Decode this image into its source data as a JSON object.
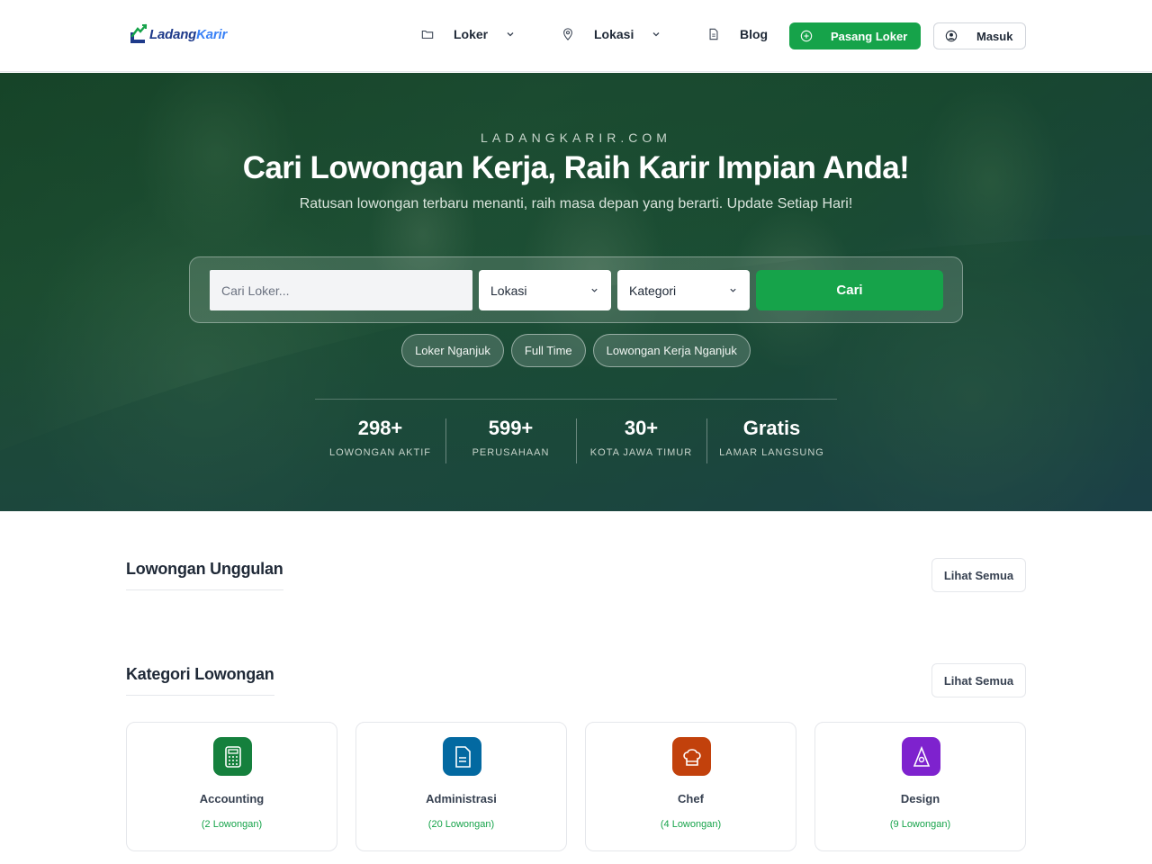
{
  "header": {
    "logo": {
      "part1": "Ladang",
      "part2": "Karir"
    },
    "nav": [
      {
        "label": "Loker",
        "icon": "folder-icon"
      },
      {
        "label": "Lokasi",
        "icon": "map-pin-icon"
      },
      {
        "label": "Blog",
        "icon": "document-icon"
      }
    ],
    "post_job_label": "Pasang Loker",
    "login_label": "Masuk"
  },
  "hero": {
    "kicker": "LADANGKARIR.COM",
    "title": "Cari Lowongan Kerja, Raih Karir Impian Anda!",
    "subtitle": "Ratusan lowongan terbaru menanti, raih masa depan yang berarti. Update Setiap Hari!",
    "search": {
      "keyword_placeholder": "Cari Loker...",
      "location_value": "Lokasi",
      "category_value": "Kategori",
      "submit_label": "Cari"
    },
    "chips": [
      "Loker Nganjuk",
      "Full Time",
      "Lowongan Kerja Nganjuk"
    ],
    "stats": [
      {
        "value": "298+",
        "label": "LOWONGAN AKTIF"
      },
      {
        "value": "599+",
        "label": "PERUSAHAAN"
      },
      {
        "value": "30+",
        "label": "KOTA JAWA TIMUR"
      },
      {
        "value": "Gratis",
        "label": "LAMAR LANGSUNG"
      }
    ]
  },
  "featured": {
    "title": "Lowongan Unggulan",
    "see_all_label": "Lihat Semua"
  },
  "categories": {
    "title": "Kategori Lowongan",
    "see_all_label": "Lihat Semua",
    "items": [
      {
        "name": "Accounting",
        "count": "(2 Lowongan)",
        "icon": "calculator-icon",
        "color": "#15803d"
      },
      {
        "name": "Administrasi",
        "count": "(20 Lowongan)",
        "icon": "document-icon",
        "color": "#0369a1"
      },
      {
        "name": "Chef",
        "count": "(4 Lowongan)",
        "icon": "chef-hat-icon",
        "color": "#c2410c"
      },
      {
        "name": "Design",
        "count": "(9 Lowongan)",
        "icon": "compass-icon",
        "color": "#7e22ce"
      }
    ]
  },
  "colors": {
    "accent": "#16a34a",
    "hero_bg": "#1f5238",
    "text": "#1f2937"
  }
}
